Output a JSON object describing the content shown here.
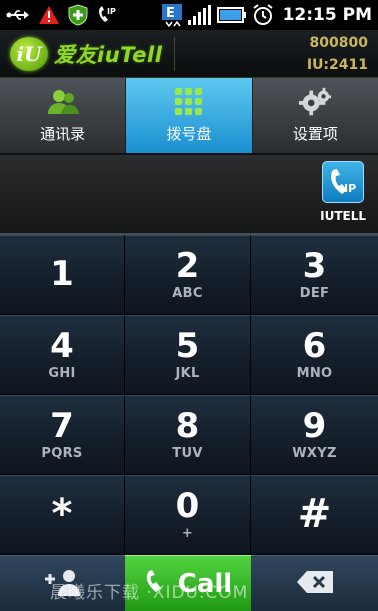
{
  "status_bar": {
    "time": "12:15 PM",
    "icons": [
      "usb-icon",
      "warning-icon",
      "shield-plus-icon",
      "ip-phone-icon",
      "network-e-icon",
      "signal-icon",
      "battery-icon",
      "alarm-icon"
    ]
  },
  "app_header": {
    "logo_badge": "iU",
    "logo_text": "爱友iuTell",
    "account_number": "800800",
    "iu_id": "IU:2411"
  },
  "tabs": [
    {
      "label": "通讯录",
      "icon": "contacts-icon",
      "active": false
    },
    {
      "label": "拨号盘",
      "icon": "dialpad-icon",
      "active": true
    },
    {
      "label": "设置项",
      "icon": "settings-icon",
      "active": false
    }
  ],
  "display": {
    "number": "",
    "ip_button_label": "IUTELL"
  },
  "keypad": [
    {
      "digit": "1",
      "letters": ""
    },
    {
      "digit": "2",
      "letters": "ABC"
    },
    {
      "digit": "3",
      "letters": "DEF"
    },
    {
      "digit": "4",
      "letters": "GHI"
    },
    {
      "digit": "5",
      "letters": "JKL"
    },
    {
      "digit": "6",
      "letters": "MNO"
    },
    {
      "digit": "7",
      "letters": "PQRS"
    },
    {
      "digit": "8",
      "letters": "TUV"
    },
    {
      "digit": "9",
      "letters": "WXYZ"
    },
    {
      "digit": "*",
      "letters": ""
    },
    {
      "digit": "0",
      "letters": "+"
    },
    {
      "digit": "#",
      "letters": ""
    }
  ],
  "actions": {
    "call_label": "Call",
    "add_contact_icon": "add-contact-icon",
    "delete_icon": "backspace-icon"
  },
  "watermark": "晨曦乐下载 ·XIDU.COM",
  "colors": {
    "active_tab": "#1a8fd0",
    "call_button": "#2ea81c",
    "logo_green": "#8fd72a",
    "account_text": "#c9b85a",
    "key_bg": "#1a2736"
  }
}
